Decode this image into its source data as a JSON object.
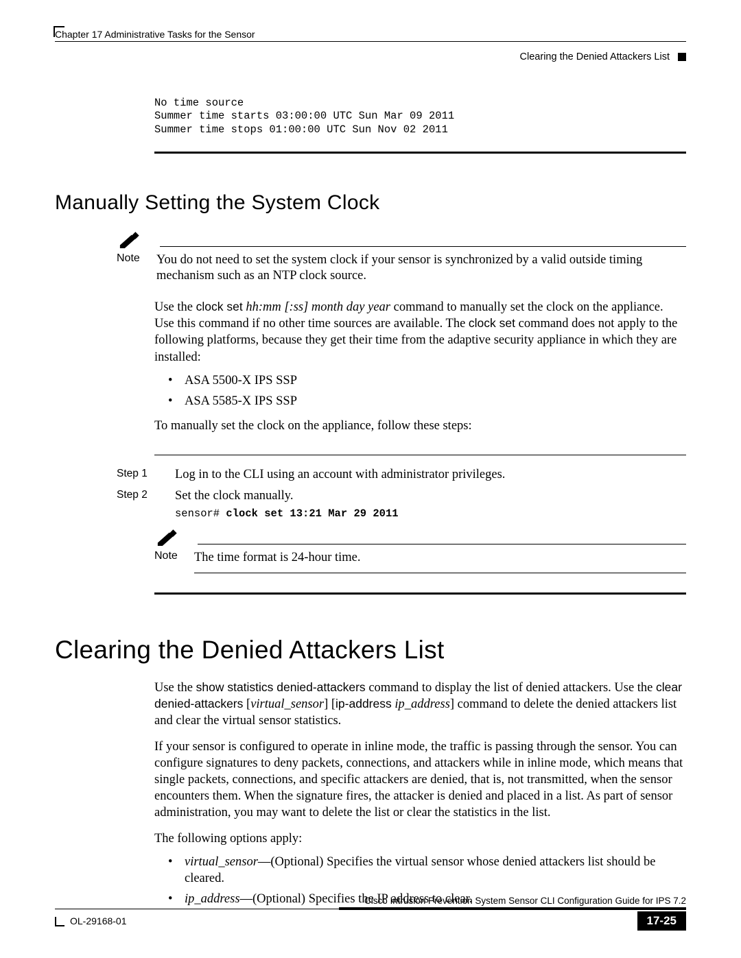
{
  "header": {
    "chapter": "Chapter 17    Administrative Tasks for the Sensor",
    "right": "Clearing the Denied Attackers List"
  },
  "codeblock1": "No time source\nSummer time starts 03:00:00 UTC Sun Mar 09 2011\nSummer time stops 01:00:00 UTC Sun Nov 02 2011",
  "h2": "Manually Setting the System Clock",
  "note1": {
    "label": "Note",
    "text": "You do not need to set the system clock if your sensor is synchronized by a valid outside timing mechanism such as an NTP clock source."
  },
  "para1": {
    "pre": "Use the ",
    "cmd": "clock set",
    "mid": " ",
    "arg": "hh:mm [:ss] month day year",
    "post1": " command to manually set the clock on the appliance. Use this command if no other time sources are available. The ",
    "cmd2": "clock set",
    "post2": " command does not apply to the following platforms, because they get their time from the adaptive security appliance in which they are installed:"
  },
  "bullets1": [
    "ASA 5500-X IPS SSP",
    "ASA 5585-X IPS SSP"
  ],
  "para2": "To manually set the clock on the appliance, follow these steps:",
  "steps": [
    {
      "label": "Step 1",
      "text": "Log in to the CLI using an account with administrator privileges."
    },
    {
      "label": "Step 2",
      "text": "Set the clock manually.",
      "code_prompt": "sensor# ",
      "code_bold": "clock set 13:21 Mar 29 2011"
    }
  ],
  "note2": {
    "label": "Note",
    "text": "The time format is 24-hour time."
  },
  "h1": "Clearing the Denied Attackers List",
  "para3": {
    "t1": "Use the ",
    "c1": "show statistics denied-attackers",
    "t2": " command to display the list of denied attackers. Use the ",
    "c2": "clear denied-attackers",
    "t3": " [",
    "i1": "virtual_sensor",
    "t4": "] [",
    "c3": "ip-address",
    "t5": " ",
    "i2": "ip_address",
    "t6": "] command to delete the denied attackers list and clear the virtual sensor statistics."
  },
  "para4": "If your sensor is configured to operate in inline mode, the traffic is passing through the sensor. You can configure signatures to deny packets, connections, and attackers while in inline mode, which means that single packets, connections, and specific attackers are denied, that is, not transmitted, when the sensor encounters them. When the signature fires, the attacker is denied and placed in a list. As part of sensor administration, you may want to delete the list or clear the statistics in the list.",
  "para5": "The following options apply:",
  "bullets2": [
    {
      "i": "virtual_sensor",
      "t": "—(Optional) Specifies the virtual sensor whose denied attackers list should be cleared."
    },
    {
      "i": "ip_address",
      "t": "—(Optional) Specifies the IP address to clear."
    }
  ],
  "footer": {
    "guide": "Cisco Intrusion Prevention System Sensor CLI Configuration Guide for IPS 7.2",
    "doc": "OL-29168-01",
    "page": "17-25"
  }
}
